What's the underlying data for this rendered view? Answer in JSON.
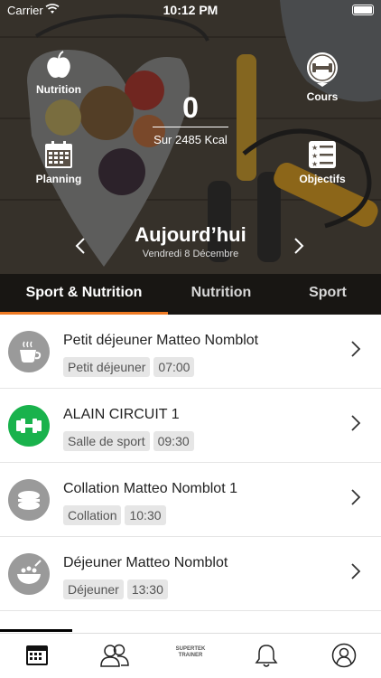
{
  "status_bar": {
    "carrier": "Carrier",
    "time": "10:12 PM"
  },
  "header": {
    "nutrition_label": "Nutrition",
    "cours_label": "Cours",
    "planning_label": "Planning",
    "objectifs_label": "Objectifs",
    "calories_value": "0",
    "calories_goal": "Sur 2485 Kcal",
    "day_title": "Aujourd’hui",
    "day_date": "Vendredi 8 Décembre"
  },
  "tabs": [
    {
      "label": "Sport & Nutrition",
      "active": true
    },
    {
      "label": "Nutrition",
      "active": false
    },
    {
      "label": "Sport",
      "active": false
    }
  ],
  "colors": {
    "accent": "#ee7a23",
    "sport_green": "#19b24c",
    "meal_grey": "#9a9a9a"
  },
  "items": [
    {
      "title": "Petit déjeuner Matteo Nomblot",
      "category": "Petit déjeuner",
      "time": "07:00",
      "icon": "coffee-cup-icon"
    },
    {
      "title": "ALAIN CIRCUIT 1",
      "category": "Salle de sport",
      "time": "09:30",
      "icon": "dumbbell-icon"
    },
    {
      "title": "Collation Matteo Nomblot 1",
      "category": "Collation",
      "time": "10:30",
      "icon": "macaron-icon"
    },
    {
      "title": "Déjeuner Matteo Nomblot",
      "category": "Déjeuner",
      "time": "13:30",
      "icon": "bowl-icon"
    }
  ],
  "tabbar": {
    "brand_top": "SUPERTEK",
    "brand_bottom": "TRAINER"
  }
}
